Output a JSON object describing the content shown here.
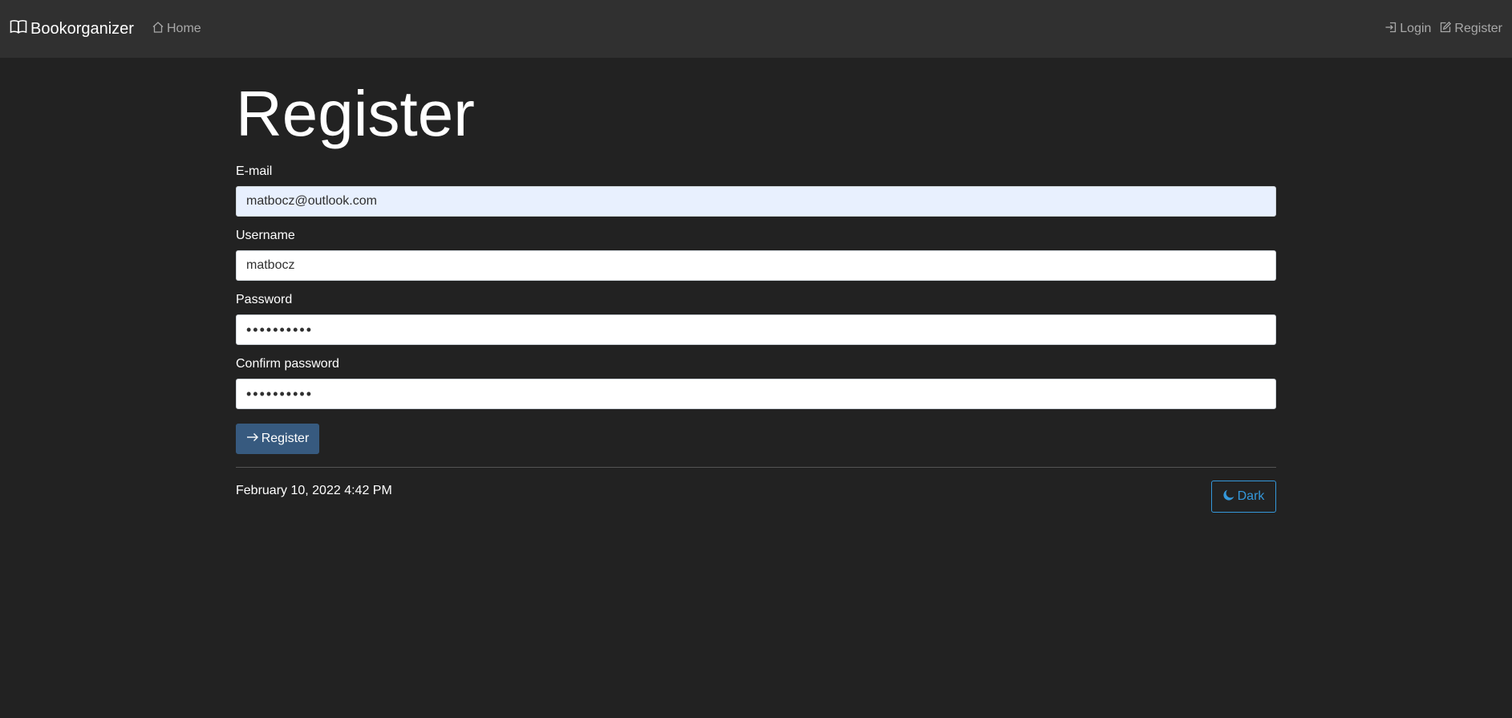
{
  "nav": {
    "brand": "Bookorganizer",
    "home": "Home",
    "login": "Login",
    "register": "Register"
  },
  "page": {
    "title": "Register"
  },
  "form": {
    "email_label": "E-mail",
    "email_value": "matbocz@outlook.com",
    "username_label": "Username",
    "username_value": "matbocz",
    "password_label": "Password",
    "password_value": "••••••••••",
    "confirm_label": "Confirm password",
    "confirm_value": "••••••••••",
    "submit_label": "Register"
  },
  "footer": {
    "timestamp": "February 10, 2022 4:42 PM",
    "theme_label": "Dark"
  },
  "colors": {
    "background": "#222222",
    "navbar": "#303030",
    "primary": "#375a7f",
    "info": "#3498db",
    "autofill": "#e8f0fe"
  },
  "icons": {
    "brand": "book-icon",
    "home": "house-icon",
    "login": "login-icon",
    "register": "edit-icon",
    "submit": "arrow-right-icon",
    "theme": "moon-icon"
  }
}
